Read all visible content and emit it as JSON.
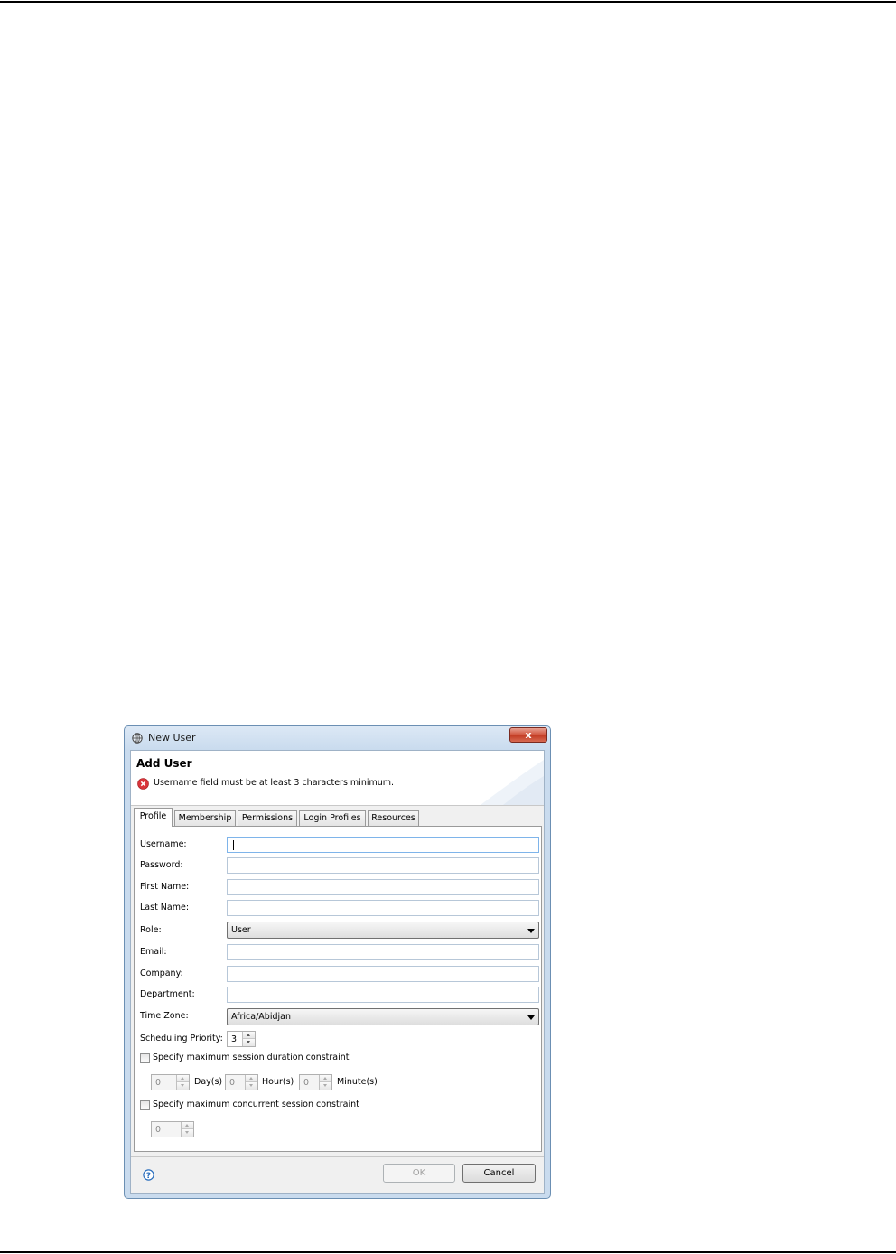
{
  "window": {
    "title": "New User",
    "close_label": "x"
  },
  "header": {
    "title": "Add User",
    "error_message": "Username field must be at least 3 characters minimum."
  },
  "tabs": [
    {
      "label": "Profile",
      "active": true
    },
    {
      "label": "Membership",
      "active": false
    },
    {
      "label": "Permissions",
      "active": false
    },
    {
      "label": "Login Profiles",
      "active": false
    },
    {
      "label": "Resources",
      "active": false
    }
  ],
  "form": {
    "username_label": "Username:",
    "username_value": "",
    "password_label": "Password:",
    "password_value": "",
    "first_name_label": "First Name:",
    "first_name_value": "",
    "last_name_label": "Last Name:",
    "last_name_value": "",
    "role_label": "Role:",
    "role_value": "User",
    "email_label": "Email:",
    "email_value": "",
    "company_label": "Company:",
    "company_value": "",
    "department_label": "Department:",
    "department_value": "",
    "time_zone_label": "Time Zone:",
    "time_zone_value": "Africa/Abidjan",
    "scheduling_priority_label": "Scheduling Priority:",
    "scheduling_priority_value": "3",
    "session_duration": {
      "checkbox_label": "Specify maximum session duration constraint",
      "checked": false,
      "days_value": "0",
      "days_label": "Day(s)",
      "hours_value": "0",
      "hours_label": "Hour(s)",
      "minutes_value": "0",
      "minutes_label": "Minute(s)"
    },
    "concurrent_session": {
      "checkbox_label": "Specify maximum concurrent session constraint",
      "checked": false,
      "value": "0"
    }
  },
  "footer": {
    "ok_label": "OK",
    "cancel_label": "Cancel"
  },
  "colors": {
    "error_red": "#d9343a",
    "help_blue": "#2a6ebd",
    "titlebar": "#c9dbee"
  },
  "icons": {
    "app": "globe-icon",
    "error": "error-icon",
    "help": "help-icon",
    "close": "close-icon"
  }
}
